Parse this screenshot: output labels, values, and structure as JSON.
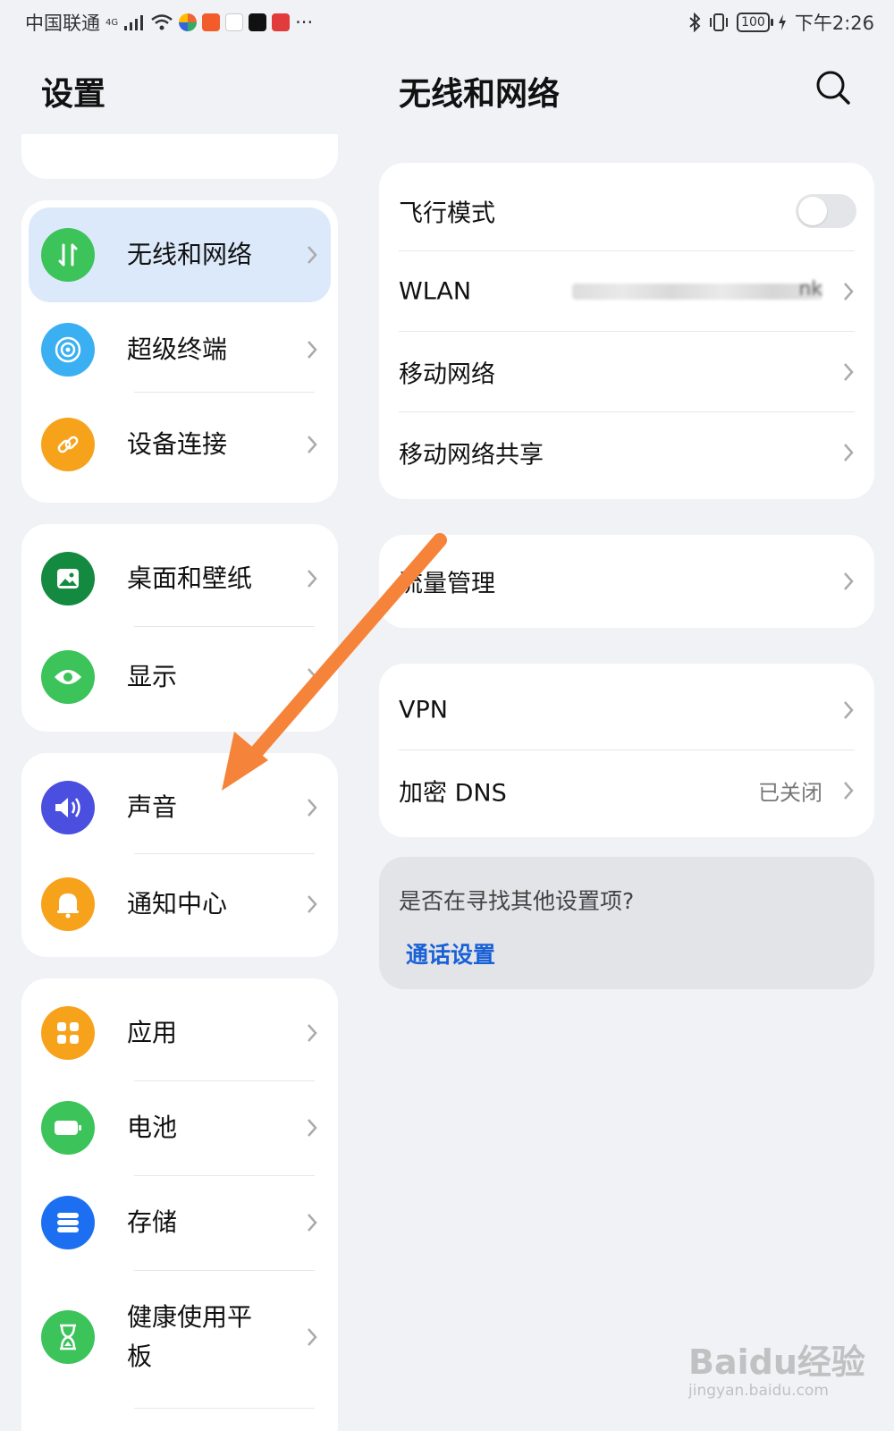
{
  "status_bar": {
    "carrier": "中国联通",
    "network": "4G",
    "more": "···",
    "battery": "100",
    "time": "下午2:26"
  },
  "settings_title": "设置",
  "left_groups": [
    {
      "items": [
        {
          "label": "无线和网络",
          "icon": "wireless-network-icon",
          "color": "#3cc35a",
          "active": true
        },
        {
          "label": "超级终端",
          "icon": "super-terminal-icon",
          "color": "#3ab0f2"
        },
        {
          "label": "设备连接",
          "icon": "link-icon",
          "color": "#f7a21b"
        }
      ]
    },
    {
      "items": [
        {
          "label": "桌面和壁纸",
          "icon": "wallpaper-icon",
          "color": "#138a3f"
        },
        {
          "label": "显示",
          "icon": "eye-icon",
          "color": "#3cc35a"
        }
      ]
    },
    {
      "items": [
        {
          "label": "声音",
          "icon": "speaker-icon",
          "color": "#4a4fe0"
        },
        {
          "label": "通知中心",
          "icon": "bell-icon",
          "color": "#f7a21b"
        }
      ]
    },
    {
      "items": [
        {
          "label": "应用",
          "icon": "apps-grid-icon",
          "color": "#f7a21b"
        },
        {
          "label": "电池",
          "icon": "battery-icon",
          "color": "#3cc35a"
        },
        {
          "label": "存储",
          "icon": "storage-icon",
          "color": "#1d6ff2"
        },
        {
          "label": "健康使用平板",
          "icon": "hourglass-icon",
          "color": "#3cc35a"
        }
      ]
    }
  ],
  "detail": {
    "title": "无线和网络",
    "group1": {
      "airplane": "飞行模式",
      "airplane_on": false,
      "wlan": "WLAN",
      "wlan_value_tail": "nk",
      "mobile": "移动网络",
      "hotspot": "移动网络共享"
    },
    "group2": {
      "traffic": "流量管理"
    },
    "group3": {
      "vpn": "VPN",
      "dns": "加密 DNS",
      "dns_value": "已关闭"
    },
    "suggest": {
      "question": "是否在寻找其他设置项?",
      "link": "通话设置"
    }
  },
  "watermark": {
    "brand": "Baidu经验",
    "url": "jingyan.baidu.com"
  },
  "colors": {
    "accent_blue": "#1961d6",
    "active_bg": "#dce9fb",
    "annotation_arrow": "#f5843a"
  }
}
